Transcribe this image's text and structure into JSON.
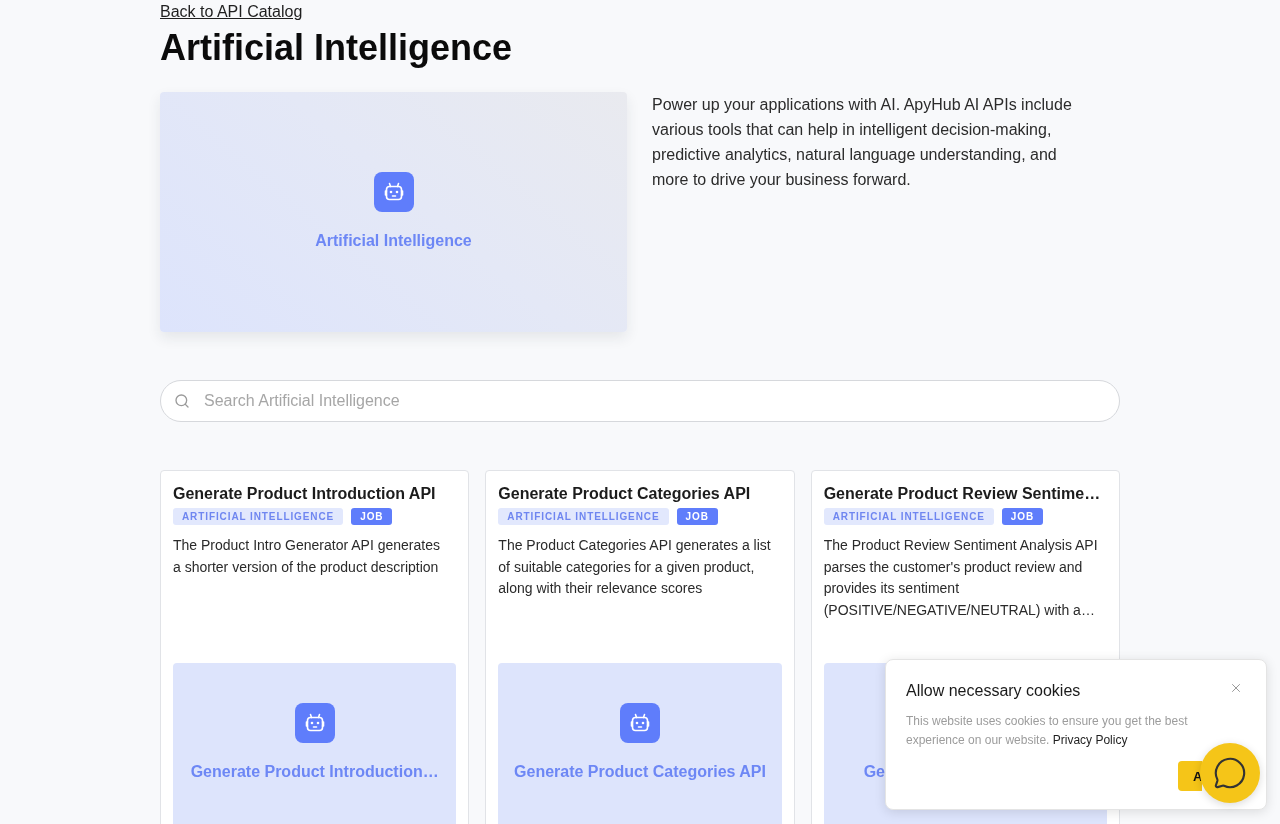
{
  "back_link": "Back to API Catalog",
  "title": "Artificial Intelligence",
  "hero": {
    "label": "Artificial Intelligence",
    "description": "Power up your applications with AI. ApyHub AI APIs include various tools that can help in intelligent decision-making, predictive analytics, natural language understanding, and more to drive your business forward."
  },
  "search": {
    "placeholder": "Search Artificial Intelligence"
  },
  "cards": [
    {
      "title": "Generate Product Introduction API",
      "tags": [
        {
          "label": "ARTIFICIAL INTELLIGENCE",
          "kind": "category"
        },
        {
          "label": "JOB",
          "kind": "type"
        }
      ],
      "description": "The Product Intro Generator API generates a shorter version of the product description",
      "thumbnail": {
        "kind": "icon_label",
        "label": "Generate Product Introduction…"
      }
    },
    {
      "title": "Generate Product Categories API",
      "tags": [
        {
          "label": "ARTIFICIAL INTELLIGENCE",
          "kind": "category"
        },
        {
          "label": "JOB",
          "kind": "type"
        }
      ],
      "description": "The Product Categories API generates a list of suitable categories for a given product, along with their relevance scores",
      "thumbnail": {
        "kind": "icon_label",
        "label": "Generate Product Categories API"
      }
    },
    {
      "title": "Generate Product Review Sentime…",
      "tags": [
        {
          "label": "ARTIFICIAL INTELLIGENCE",
          "kind": "category"
        },
        {
          "label": "JOB",
          "kind": "type"
        }
      ],
      "description": "The Product Review Sentiment Analysis API parses the customer's product review and provides its sentiment (POSITIVE/NEGATIVE/NEUTRAL) with a…",
      "thumbnail": {
        "kind": "label",
        "label": "Ge"
      }
    }
  ],
  "cookie_banner": {
    "title": "Allow necessary cookies",
    "text": "This website uses cookies to ensure you get the best experience on our website.",
    "link": "Privacy Policy",
    "button": "A"
  }
}
